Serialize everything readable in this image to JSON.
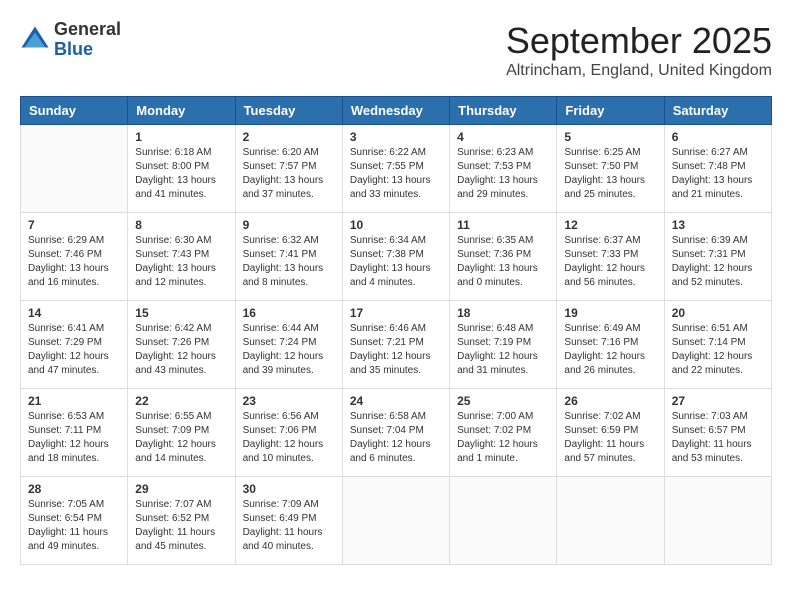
{
  "header": {
    "logo": {
      "general": "General",
      "blue": "Blue"
    },
    "title": "September 2025",
    "location": "Altrincham, England, United Kingdom"
  },
  "calendar": {
    "weekdays": [
      "Sunday",
      "Monday",
      "Tuesday",
      "Wednesday",
      "Thursday",
      "Friday",
      "Saturday"
    ],
    "weeks": [
      [
        {
          "day": "",
          "sunrise": "",
          "sunset": "",
          "daylight": ""
        },
        {
          "day": "1",
          "sunrise": "Sunrise: 6:18 AM",
          "sunset": "Sunset: 8:00 PM",
          "daylight": "Daylight: 13 hours and 41 minutes."
        },
        {
          "day": "2",
          "sunrise": "Sunrise: 6:20 AM",
          "sunset": "Sunset: 7:57 PM",
          "daylight": "Daylight: 13 hours and 37 minutes."
        },
        {
          "day": "3",
          "sunrise": "Sunrise: 6:22 AM",
          "sunset": "Sunset: 7:55 PM",
          "daylight": "Daylight: 13 hours and 33 minutes."
        },
        {
          "day": "4",
          "sunrise": "Sunrise: 6:23 AM",
          "sunset": "Sunset: 7:53 PM",
          "daylight": "Daylight: 13 hours and 29 minutes."
        },
        {
          "day": "5",
          "sunrise": "Sunrise: 6:25 AM",
          "sunset": "Sunset: 7:50 PM",
          "daylight": "Daylight: 13 hours and 25 minutes."
        },
        {
          "day": "6",
          "sunrise": "Sunrise: 6:27 AM",
          "sunset": "Sunset: 7:48 PM",
          "daylight": "Daylight: 13 hours and 21 minutes."
        }
      ],
      [
        {
          "day": "7",
          "sunrise": "Sunrise: 6:29 AM",
          "sunset": "Sunset: 7:46 PM",
          "daylight": "Daylight: 13 hours and 16 minutes."
        },
        {
          "day": "8",
          "sunrise": "Sunrise: 6:30 AM",
          "sunset": "Sunset: 7:43 PM",
          "daylight": "Daylight: 13 hours and 12 minutes."
        },
        {
          "day": "9",
          "sunrise": "Sunrise: 6:32 AM",
          "sunset": "Sunset: 7:41 PM",
          "daylight": "Daylight: 13 hours and 8 minutes."
        },
        {
          "day": "10",
          "sunrise": "Sunrise: 6:34 AM",
          "sunset": "Sunset: 7:38 PM",
          "daylight": "Daylight: 13 hours and 4 minutes."
        },
        {
          "day": "11",
          "sunrise": "Sunrise: 6:35 AM",
          "sunset": "Sunset: 7:36 PM",
          "daylight": "Daylight: 13 hours and 0 minutes."
        },
        {
          "day": "12",
          "sunrise": "Sunrise: 6:37 AM",
          "sunset": "Sunset: 7:33 PM",
          "daylight": "Daylight: 12 hours and 56 minutes."
        },
        {
          "day": "13",
          "sunrise": "Sunrise: 6:39 AM",
          "sunset": "Sunset: 7:31 PM",
          "daylight": "Daylight: 12 hours and 52 minutes."
        }
      ],
      [
        {
          "day": "14",
          "sunrise": "Sunrise: 6:41 AM",
          "sunset": "Sunset: 7:29 PM",
          "daylight": "Daylight: 12 hours and 47 minutes."
        },
        {
          "day": "15",
          "sunrise": "Sunrise: 6:42 AM",
          "sunset": "Sunset: 7:26 PM",
          "daylight": "Daylight: 12 hours and 43 minutes."
        },
        {
          "day": "16",
          "sunrise": "Sunrise: 6:44 AM",
          "sunset": "Sunset: 7:24 PM",
          "daylight": "Daylight: 12 hours and 39 minutes."
        },
        {
          "day": "17",
          "sunrise": "Sunrise: 6:46 AM",
          "sunset": "Sunset: 7:21 PM",
          "daylight": "Daylight: 12 hours and 35 minutes."
        },
        {
          "day": "18",
          "sunrise": "Sunrise: 6:48 AM",
          "sunset": "Sunset: 7:19 PM",
          "daylight": "Daylight: 12 hours and 31 minutes."
        },
        {
          "day": "19",
          "sunrise": "Sunrise: 6:49 AM",
          "sunset": "Sunset: 7:16 PM",
          "daylight": "Daylight: 12 hours and 26 minutes."
        },
        {
          "day": "20",
          "sunrise": "Sunrise: 6:51 AM",
          "sunset": "Sunset: 7:14 PM",
          "daylight": "Daylight: 12 hours and 22 minutes."
        }
      ],
      [
        {
          "day": "21",
          "sunrise": "Sunrise: 6:53 AM",
          "sunset": "Sunset: 7:11 PM",
          "daylight": "Daylight: 12 hours and 18 minutes."
        },
        {
          "day": "22",
          "sunrise": "Sunrise: 6:55 AM",
          "sunset": "Sunset: 7:09 PM",
          "daylight": "Daylight: 12 hours and 14 minutes."
        },
        {
          "day": "23",
          "sunrise": "Sunrise: 6:56 AM",
          "sunset": "Sunset: 7:06 PM",
          "daylight": "Daylight: 12 hours and 10 minutes."
        },
        {
          "day": "24",
          "sunrise": "Sunrise: 6:58 AM",
          "sunset": "Sunset: 7:04 PM",
          "daylight": "Daylight: 12 hours and 6 minutes."
        },
        {
          "day": "25",
          "sunrise": "Sunrise: 7:00 AM",
          "sunset": "Sunset: 7:02 PM",
          "daylight": "Daylight: 12 hours and 1 minute."
        },
        {
          "day": "26",
          "sunrise": "Sunrise: 7:02 AM",
          "sunset": "Sunset: 6:59 PM",
          "daylight": "Daylight: 11 hours and 57 minutes."
        },
        {
          "day": "27",
          "sunrise": "Sunrise: 7:03 AM",
          "sunset": "Sunset: 6:57 PM",
          "daylight": "Daylight: 11 hours and 53 minutes."
        }
      ],
      [
        {
          "day": "28",
          "sunrise": "Sunrise: 7:05 AM",
          "sunset": "Sunset: 6:54 PM",
          "daylight": "Daylight: 11 hours and 49 minutes."
        },
        {
          "day": "29",
          "sunrise": "Sunrise: 7:07 AM",
          "sunset": "Sunset: 6:52 PM",
          "daylight": "Daylight: 11 hours and 45 minutes."
        },
        {
          "day": "30",
          "sunrise": "Sunrise: 7:09 AM",
          "sunset": "Sunset: 6:49 PM",
          "daylight": "Daylight: 11 hours and 40 minutes."
        },
        {
          "day": "",
          "sunrise": "",
          "sunset": "",
          "daylight": ""
        },
        {
          "day": "",
          "sunrise": "",
          "sunset": "",
          "daylight": ""
        },
        {
          "day": "",
          "sunrise": "",
          "sunset": "",
          "daylight": ""
        },
        {
          "day": "",
          "sunrise": "",
          "sunset": "",
          "daylight": ""
        }
      ]
    ]
  }
}
